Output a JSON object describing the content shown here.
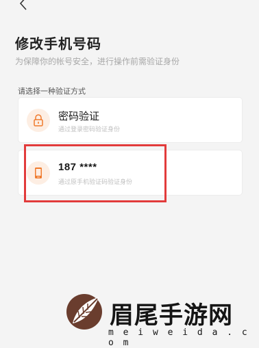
{
  "header": {
    "title": "修改手机号码",
    "subtitle": "为保障你的帐号安全，进行操作前需验证身份"
  },
  "section_label": "请选择一种验证方式",
  "options": [
    {
      "title": "密码验证",
      "description": "通过登录密码验证身份",
      "icon": "lock-icon"
    },
    {
      "title": "187 ****",
      "description": "通过原手机验证码验证身份",
      "icon": "phone-icon"
    }
  ],
  "watermark": {
    "brand": "眉尾手游网",
    "url": "m e i w e i d a . c o m"
  },
  "colors": {
    "accent": "#f07a2c",
    "icon_bg": "#fdeee3",
    "highlight": "#e23b3b",
    "background": "#f4f4f4"
  }
}
